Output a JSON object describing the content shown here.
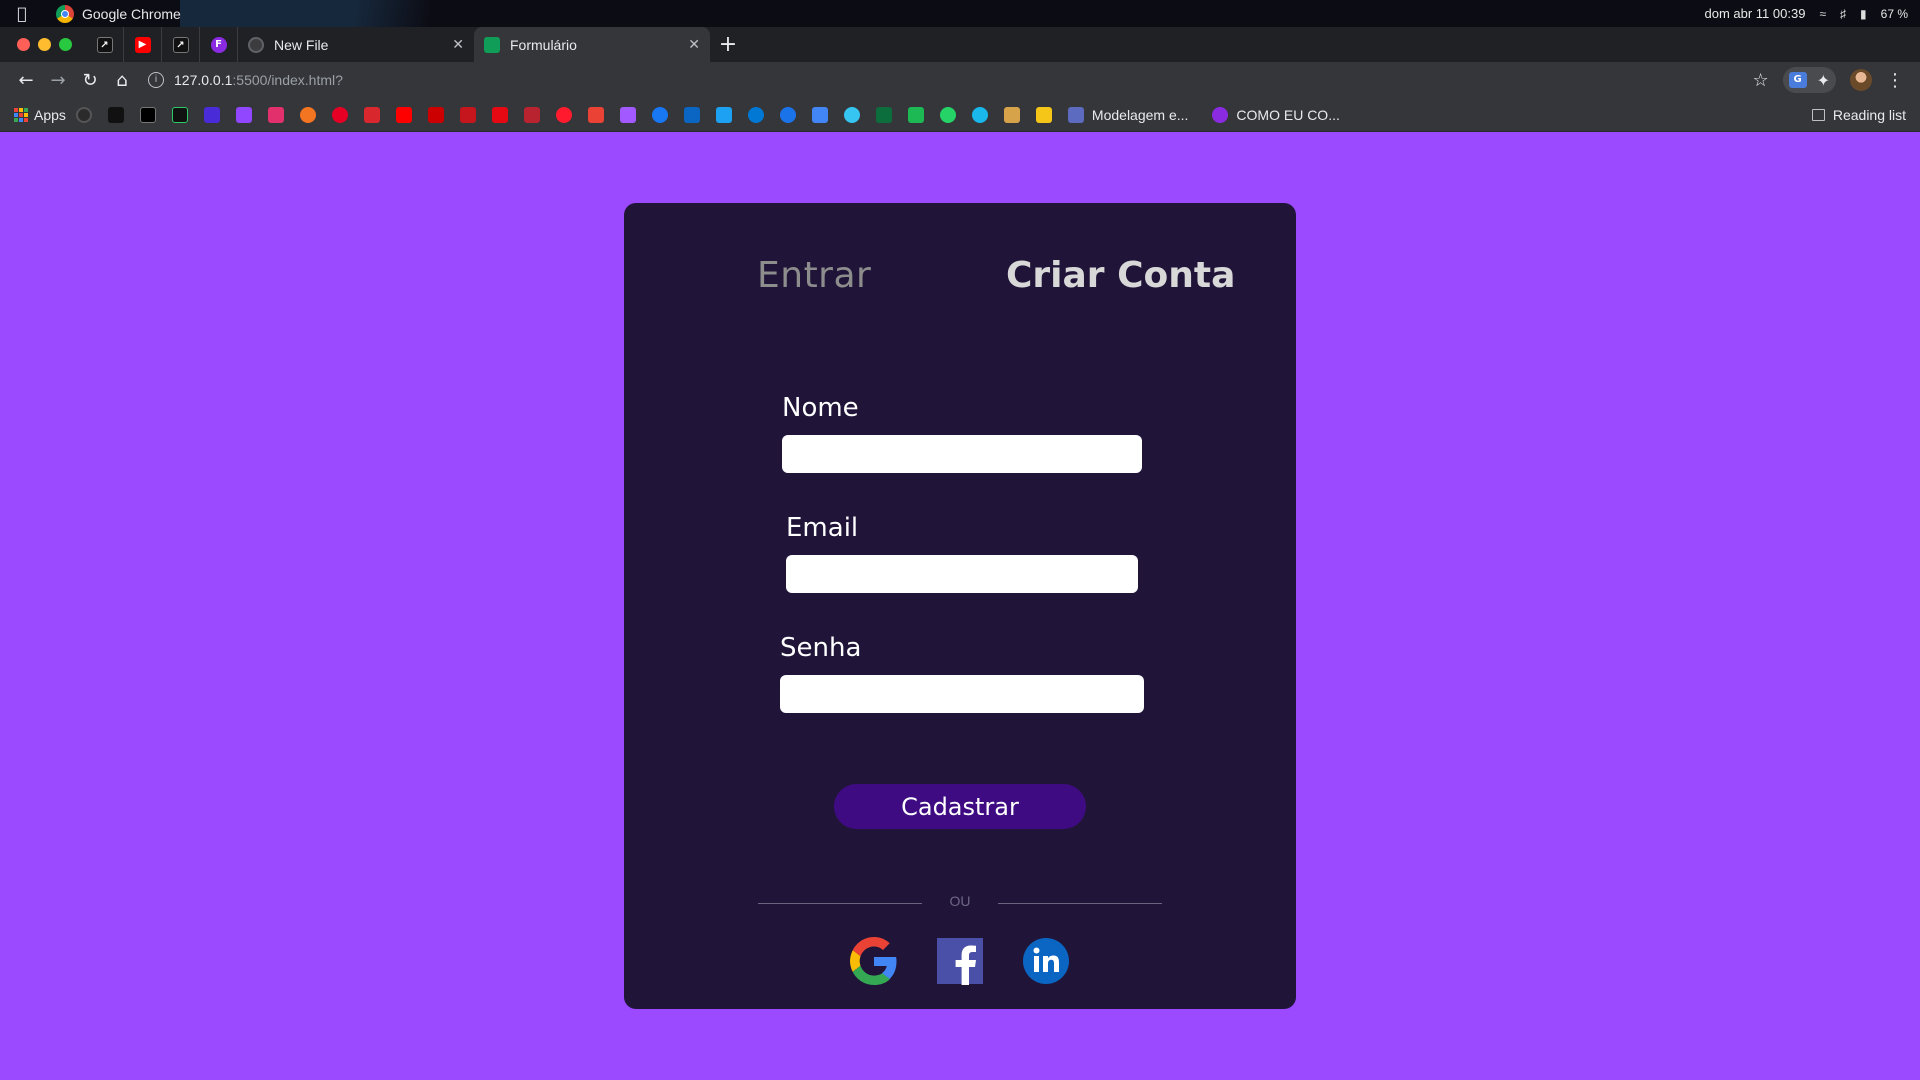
{
  "os_bar": {
    "app_name": "Google Chrome",
    "datetime": "dom abr 11  00:39",
    "battery": "67 %"
  },
  "browser": {
    "tabs": [
      {
        "label": "New File",
        "active": false,
        "icon": "github-icon"
      },
      {
        "label": "Formulário",
        "active": true,
        "icon": "sheets-icon"
      }
    ],
    "url_host": "127.0.0.1",
    "url_path": ":5500/index.html?",
    "bookmarks": {
      "apps_label": "Apps",
      "folder_1": "Modelagem e...",
      "folder_2": "COMO EU CO...",
      "reading_list": "Reading list"
    }
  },
  "page": {
    "tab_login": "Entrar",
    "tab_signup": "Criar Conta",
    "fields": {
      "name_label": "Nome",
      "email_label": "Email",
      "password_label": "Senha"
    },
    "submit_label": "Cadastrar",
    "divider_text": "OU",
    "social": [
      "google-icon",
      "facebook-icon",
      "linkedin-icon"
    ]
  },
  "colors": {
    "page_background": "#9c4aff",
    "card_background": "#201538",
    "button_background": "#3f0b82"
  }
}
